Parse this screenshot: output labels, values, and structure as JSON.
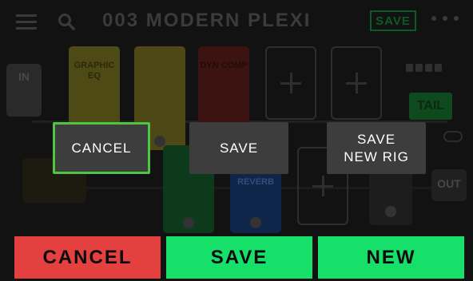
{
  "header": {
    "preset_name": "003 MODERN PLEXI",
    "save_label": "SAVE",
    "menu_icon": "hamburger-icon",
    "search_icon": "search-icon",
    "more_icon": "more-dots-icon"
  },
  "signal_chain": {
    "input_label": "IN",
    "blocks": [
      "GRAPHIC EQ",
      "",
      "DYN COMP",
      "",
      "REVERB"
    ],
    "tail_label": "TAIL",
    "output_label": "OUT"
  },
  "dialog": {
    "cancel_label": "CANCEL",
    "save_label": "SAVE",
    "save_new_rig_label": "SAVE\nNEW RIG"
  },
  "bottom_bar": {
    "cancel_label": "CANCEL",
    "save_label": "SAVE",
    "new_label": "NEW"
  },
  "colors": {
    "background": "#121212",
    "dialog_button": "#3d3d3d",
    "focus_border": "#4ec641",
    "cancel": "#e3403f",
    "save": "#17e06a"
  }
}
